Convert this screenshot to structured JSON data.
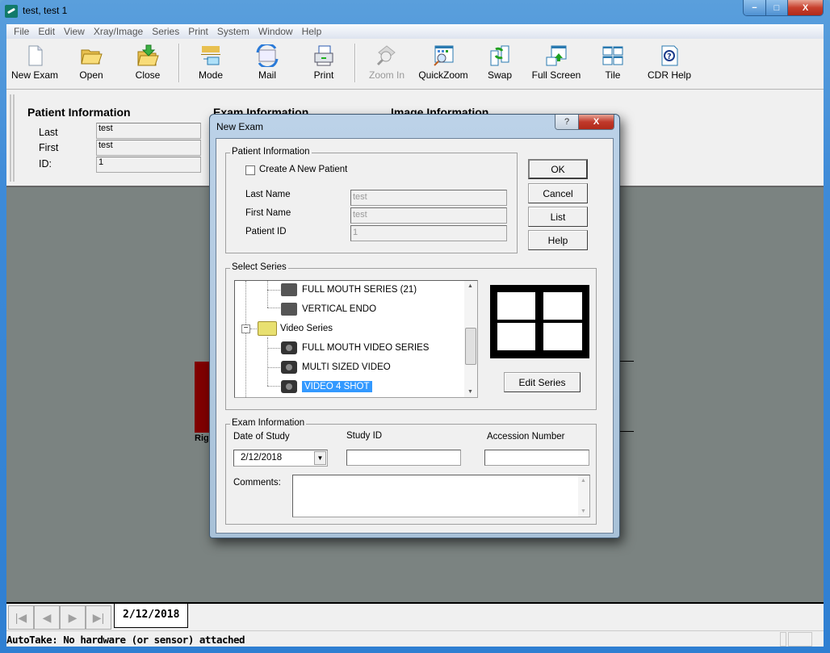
{
  "window": {
    "title": "test, test 1",
    "controls": {
      "minimize": "−",
      "maximize": "□",
      "close": "X"
    }
  },
  "menu": [
    "File",
    "Edit",
    "View",
    "Xray/Image",
    "Series",
    "Print",
    "System",
    "Window",
    "Help"
  ],
  "toolbar": [
    {
      "label": "New Exam",
      "icon": "new-document-icon",
      "enabled": true
    },
    {
      "label": "Open",
      "icon": "open-folder-icon",
      "enabled": true
    },
    {
      "label": "Close",
      "icon": "close-folder-icon",
      "enabled": true
    },
    {
      "label": "Mode",
      "icon": "mode-icon",
      "enabled": true
    },
    {
      "label": "Mail",
      "icon": "mail-icon",
      "enabled": true
    },
    {
      "label": "Print",
      "icon": "printer-icon",
      "enabled": true
    },
    {
      "label": "Zoom In",
      "icon": "zoom-in-icon",
      "enabled": false
    },
    {
      "label": "QuickZoom",
      "icon": "quickzoom-icon",
      "enabled": true
    },
    {
      "label": "Swap",
      "icon": "swap-icon",
      "enabled": true
    },
    {
      "label": "Full Screen",
      "icon": "full-screen-icon",
      "enabled": true
    },
    {
      "label": "Tile",
      "icon": "tile-icon",
      "enabled": true
    },
    {
      "label": "CDR Help",
      "icon": "help-icon",
      "enabled": true
    }
  ],
  "patient_panel": {
    "title": "Patient Information",
    "fields": [
      {
        "label": "Last",
        "value": "test"
      },
      {
        "label": "First",
        "value": "test"
      },
      {
        "label": "ID:",
        "value": "1"
      }
    ],
    "exam_title": "Exam Information",
    "image_title": "Image Information"
  },
  "viewer": {
    "partial_label": "Rig",
    "accent_color": "#800000"
  },
  "tabs": {
    "nav": [
      "first",
      "previous",
      "next",
      "last"
    ],
    "active_tab": "2/12/2018"
  },
  "status": {
    "text": "AutoTake: No hardware (or sensor) attached"
  },
  "dialog": {
    "title": "New Exam",
    "help_glyph": "?",
    "close_glyph": "X",
    "patient_group": {
      "label": "Patient Information",
      "create_new_label": "Create A New Patient",
      "create_new_checked": false,
      "last_name_label": "Last Name",
      "last_name": "test",
      "first_name_label": "First Name",
      "first_name": "test",
      "patient_id_label": "Patient ID",
      "patient_id": "1"
    },
    "buttons": {
      "ok": "OK",
      "cancel": "Cancel",
      "list": "List",
      "help": "Help",
      "edit_series": "Edit Series"
    },
    "series_group": {
      "label": "Select Series",
      "items": [
        {
          "label": "FULL MOUTH SERIES (21)",
          "type": "xray",
          "selected": false
        },
        {
          "label": "VERTICAL ENDO",
          "type": "xray",
          "selected": false
        },
        {
          "label": "Video Series",
          "type": "folder",
          "selected": false
        },
        {
          "label": "FULL MOUTH VIDEO SERIES",
          "type": "video",
          "selected": false
        },
        {
          "label": "MULTI SIZED VIDEO",
          "type": "video",
          "selected": false
        },
        {
          "label": "VIDEO 4 SHOT",
          "type": "video",
          "selected": true
        }
      ],
      "preview_layout": "2x2"
    },
    "exam_group": {
      "label": "Exam Information",
      "date_label": "Date of Study",
      "date_value": "2/12/2018",
      "study_id_label": "Study ID",
      "study_id_value": "",
      "accession_label": "Accession Number",
      "accession_value": "",
      "comments_label": "Comments:",
      "comments_value": ""
    }
  }
}
